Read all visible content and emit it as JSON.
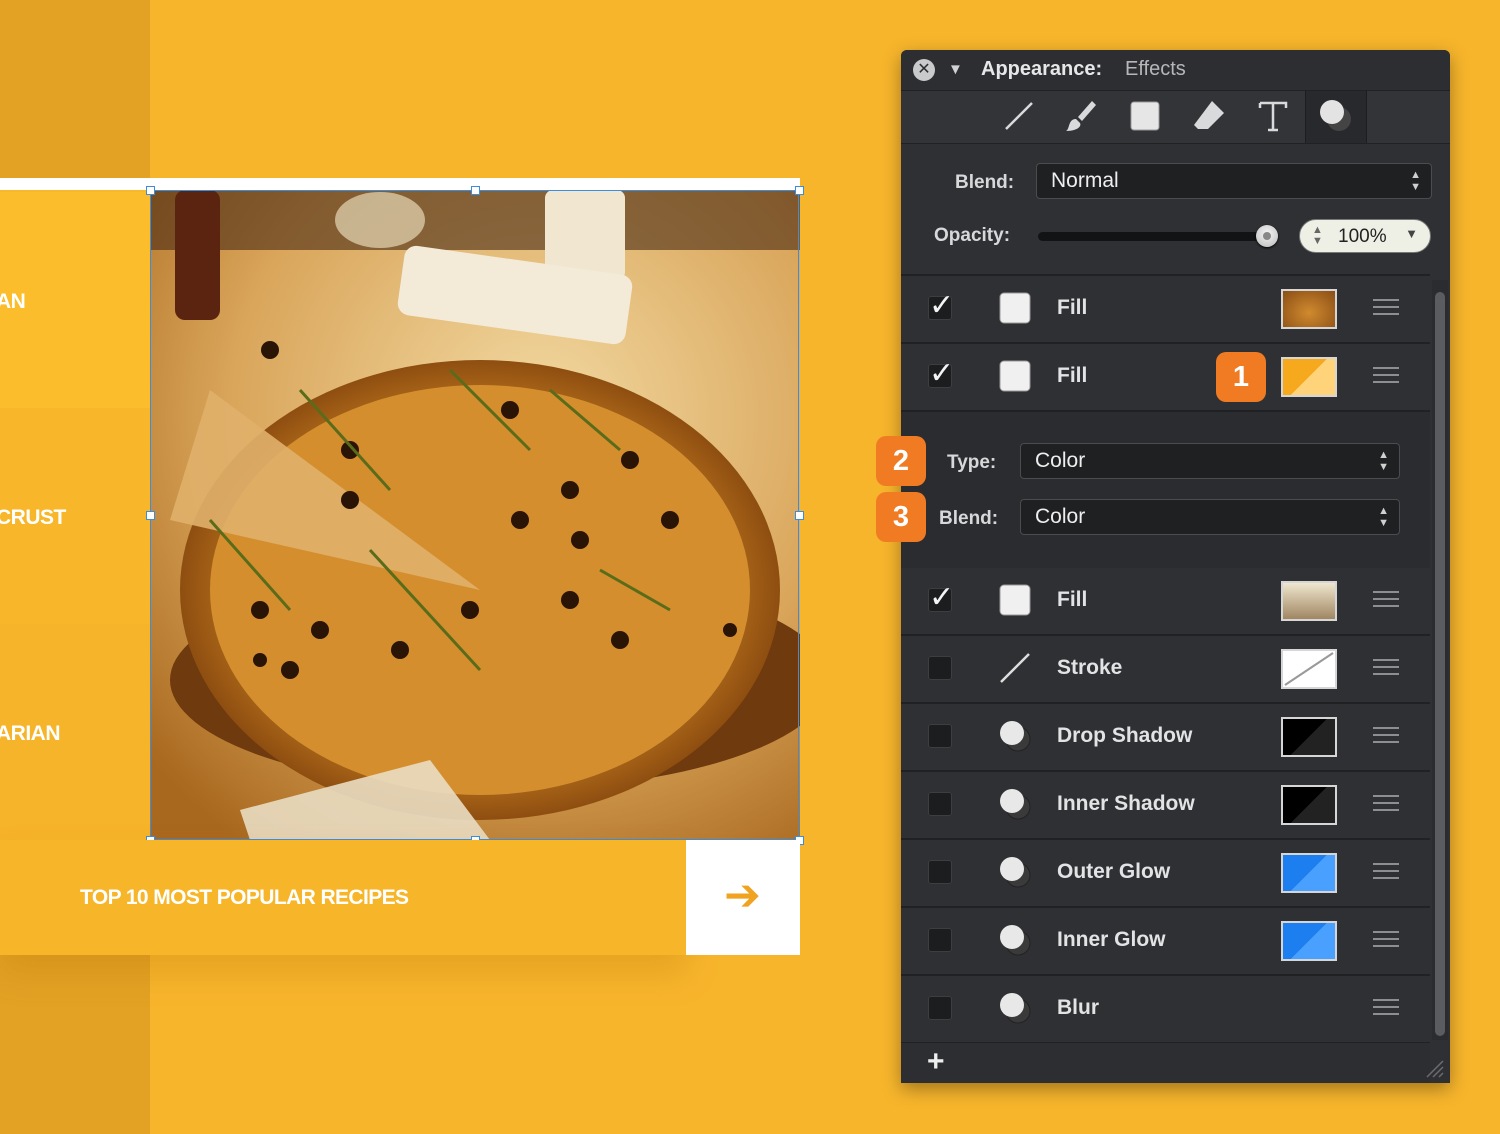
{
  "canvas": {
    "menu_items": [
      "AN",
      "CRUST",
      "ARIAN"
    ],
    "footer_title": "TOP 10 MOST POPULAR RECIPES",
    "arrow": "➔"
  },
  "panel": {
    "title_label": "Appearance:",
    "title_value": "Effects",
    "close_glyph": "✕",
    "disclose_glyph": "▼",
    "tools": [
      "line-tool-icon",
      "brush-tool-icon",
      "fill-square-icon",
      "eraser-tool-icon",
      "text-tool-icon",
      "effects-icon"
    ],
    "blend_label": "Blend:",
    "blend_value": "Normal",
    "opacity_label": "Opacity:",
    "opacity_value": "100%",
    "opacity_level": 1.0,
    "layers": [
      {
        "checked": true,
        "label": "Fill",
        "swatch": "image",
        "check": "✓"
      },
      {
        "checked": true,
        "label": "Fill",
        "swatch": "orange-gradient",
        "check": "✓"
      },
      {
        "checked": true,
        "label": "Fill",
        "swatch": "beige-gradient",
        "check": "✓"
      },
      {
        "checked": false,
        "label": "Stroke",
        "swatch": "none",
        "check": ""
      },
      {
        "checked": false,
        "label": "Drop Shadow",
        "swatch": "black",
        "check": ""
      },
      {
        "checked": false,
        "label": "Inner Shadow",
        "swatch": "black",
        "check": ""
      },
      {
        "checked": false,
        "label": "Outer Glow",
        "swatch": "blue",
        "check": ""
      },
      {
        "checked": false,
        "label": "Inner Glow",
        "swatch": "blue",
        "check": ""
      },
      {
        "checked": false,
        "label": "Blur",
        "swatch": "",
        "check": ""
      }
    ],
    "fill_options": {
      "type_label": "Type:",
      "type_value": "Color",
      "blend_label": "Blend:",
      "blend_value": "Color"
    },
    "badges": [
      "1",
      "2",
      "3"
    ],
    "add_glyph": "+"
  },
  "colors": {
    "background": "#f7b52c",
    "panel": "#2e3033",
    "badge": "#f07b22",
    "selection": "#3b8de0",
    "arrow": "#f0a321"
  }
}
